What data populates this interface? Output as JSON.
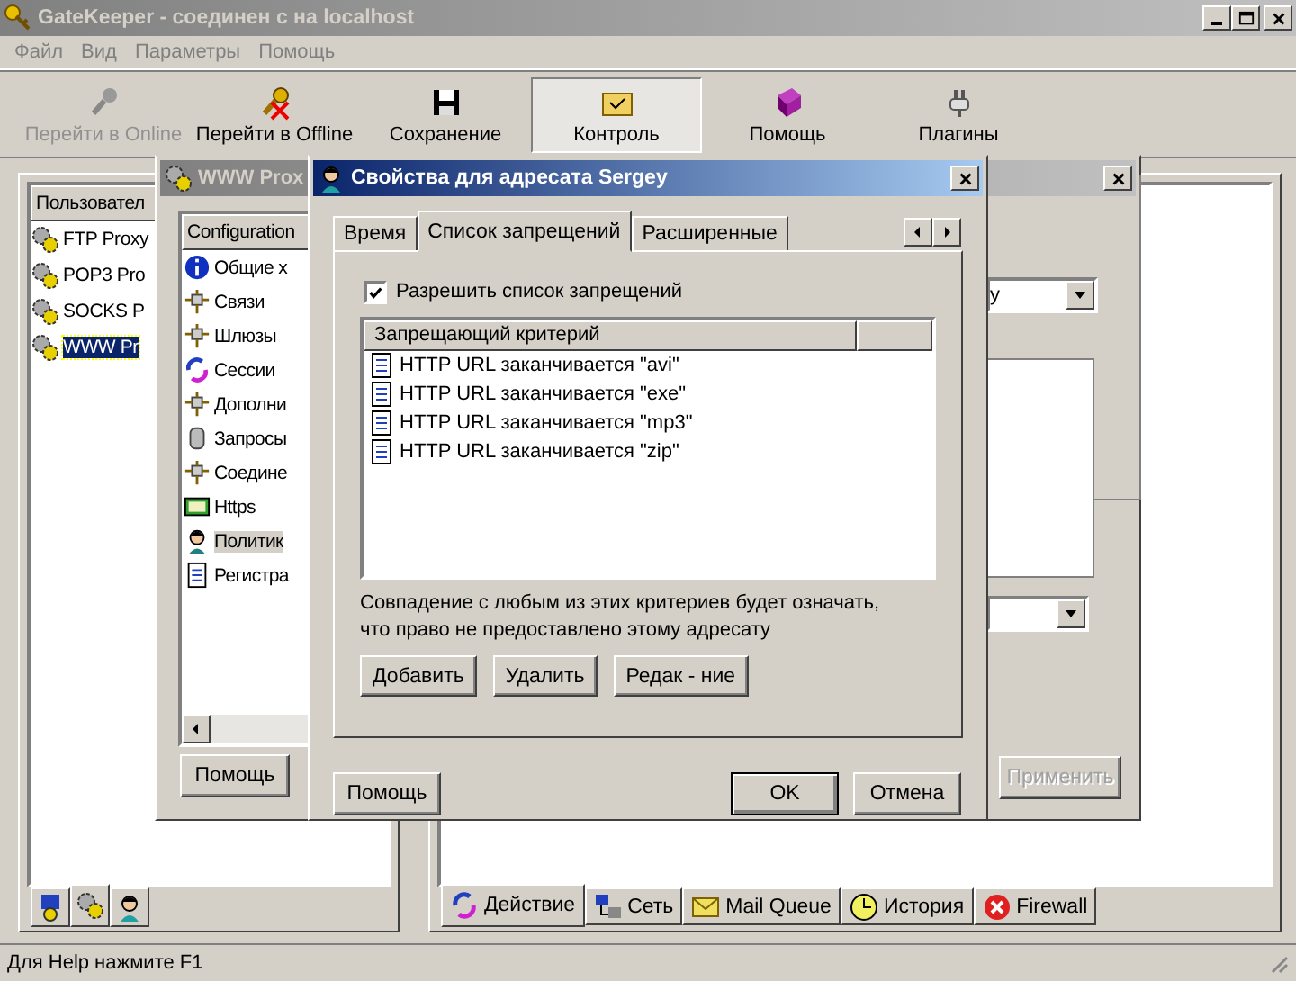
{
  "main_window": {
    "title": "GateKeeper - соединен с на localhost",
    "active": false
  },
  "menu": {
    "disabled": true,
    "items": [
      "Файл",
      "Вид",
      "Параметры",
      "Помощь"
    ]
  },
  "toolbar": [
    {
      "label": "Перейти в Online",
      "disabled": true,
      "selected": false
    },
    {
      "label": "Перейти в Offline",
      "disabled": false,
      "selected": false
    },
    {
      "label": "Сохранение",
      "disabled": false,
      "selected": false
    },
    {
      "label": "Контроль",
      "disabled": false,
      "selected": true
    },
    {
      "label": "Помощь",
      "disabled": false,
      "selected": false
    },
    {
      "label": "Плагины",
      "disabled": false,
      "selected": false
    }
  ],
  "services_panel": {
    "header": "Пользовател",
    "items": [
      {
        "label": "FTP Proxy",
        "selected": false
      },
      {
        "label": "POP3 Pro",
        "selected": false
      },
      {
        "label": "SOCKS P",
        "selected": false
      },
      {
        "label": "WWW Pr",
        "selected": true
      }
    ],
    "tabs": [
      {
        "selected": false
      },
      {
        "selected": true
      },
      {
        "selected": false
      }
    ]
  },
  "activity_panel": {
    "tabs": [
      {
        "label": "Действие",
        "selected": true
      },
      {
        "label": "Сеть",
        "selected": false
      },
      {
        "label": "Mail Queue",
        "selected": false
      },
      {
        "label": "История",
        "selected": false
      },
      {
        "label": "Firewall",
        "selected": false
      }
    ]
  },
  "proxy_window": {
    "title": "WWW Prox",
    "active": false,
    "tree_header": "Configuration",
    "tree": [
      {
        "label": "Общие х",
        "selected": false
      },
      {
        "label": "Связи",
        "selected": false
      },
      {
        "label": "Шлюзы",
        "selected": false
      },
      {
        "label": "Сессии",
        "selected": false
      },
      {
        "label": "Дополни",
        "selected": false
      },
      {
        "label": "Запросы",
        "selected": false
      },
      {
        "label": "Соедине",
        "selected": false
      },
      {
        "label": "Https",
        "selected": false
      },
      {
        "label": "Политик",
        "selected": true
      },
      {
        "label": "Регистра",
        "selected": false
      }
    ],
    "dropdown_value": "y",
    "help_button": "Помощь",
    "apply_button": {
      "label": "Применить",
      "disabled": true
    }
  },
  "dialog": {
    "title": "Свойства для адресата Sergey",
    "active": true,
    "tabs": [
      {
        "label": "Время",
        "selected": false
      },
      {
        "label": "Список запрещений",
        "selected": true
      },
      {
        "label": "Расширенные",
        "selected": false
      }
    ],
    "enable_checkbox": {
      "label": "Разрешить список запрещений",
      "checked": true
    },
    "list_header": "Запрещающий критерий",
    "rules": [
      "HTTP URL заканчивается \"avi\"",
      "HTTP URL заканчивается \"exe\"",
      "HTTP URL заканчивается \"mp3\"",
      "HTTP URL заканчивается \"zip\""
    ],
    "note": "Совпадение с любым из этих критериев будет означать, что право не предоставлено этому адресату",
    "list_buttons": [
      "Добавить",
      "Удалить",
      "Редак - ние"
    ],
    "help_button": "Помощь",
    "ok_button": "OK",
    "cancel_button": "Отмена"
  },
  "status_bar": "Для Help нажмите F1"
}
